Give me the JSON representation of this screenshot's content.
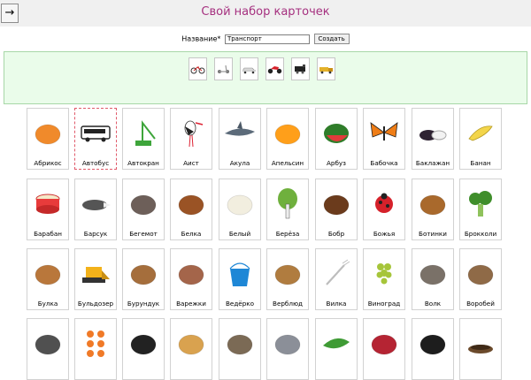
{
  "header": {
    "back_glyph": "→",
    "title": "Свой набор карточек"
  },
  "form": {
    "name_label": "Название*",
    "name_value": "Транспорт",
    "create_label": "Создать"
  },
  "selected": [
    {
      "icon": "bicycle-icon"
    },
    {
      "icon": "scooter-icon"
    },
    {
      "icon": "car-icon"
    },
    {
      "icon": "motorcycle-icon"
    },
    {
      "icon": "locomotive-icon"
    },
    {
      "icon": "truck-icon"
    }
  ],
  "cards": [
    {
      "label": "Абрикос",
      "icon": "apricot-icon",
      "color": "#f08a2b"
    },
    {
      "label": "Автобус",
      "icon": "bus-icon",
      "color": "#ffffff",
      "selected": true
    },
    {
      "label": "Автокран",
      "icon": "crane-icon",
      "color": "#3ea53b"
    },
    {
      "label": "Аист",
      "icon": "stork-icon",
      "color": "#ffffff"
    },
    {
      "label": "Акула",
      "icon": "shark-icon",
      "color": "#5c6b7a"
    },
    {
      "label": "Апельсин",
      "icon": "orange-icon",
      "color": "#ff9f1a"
    },
    {
      "label": "Арбуз",
      "icon": "watermelon-icon",
      "color": "#e23b3b"
    },
    {
      "label": "Бабочка",
      "icon": "butterfly-icon",
      "color": "#ef7d16"
    },
    {
      "label": "Баклажан",
      "icon": "eggplant-icon",
      "color": "#2e2232"
    },
    {
      "label": "Банан",
      "icon": "banana-icon",
      "color": "#f3d54a"
    },
    {
      "label": "Барабан",
      "icon": "drum-icon",
      "color": "#e83b3b"
    },
    {
      "label": "Барсук",
      "icon": "badger-icon",
      "color": "#555555"
    },
    {
      "label": "Бегемот",
      "icon": "hippo-icon",
      "color": "#6d5f59"
    },
    {
      "label": "Белка",
      "icon": "squirrel-icon",
      "color": "#9a5325"
    },
    {
      "label": "Белый",
      "icon": "polar-bear-icon",
      "color": "#f2eedf"
    },
    {
      "label": "Берёза",
      "icon": "birch-icon",
      "color": "#6fb03d"
    },
    {
      "label": "Бобр",
      "icon": "beaver-icon",
      "color": "#6b3b1c"
    },
    {
      "label": "Божья",
      "icon": "ladybug-icon",
      "color": "#d5212a"
    },
    {
      "label": "Ботинки",
      "icon": "boots-icon",
      "color": "#a9692c"
    },
    {
      "label": "Брокколи",
      "icon": "broccoli-icon",
      "color": "#3f8e2b"
    },
    {
      "label": "Булка",
      "icon": "bread-icon",
      "color": "#b9773b"
    },
    {
      "label": "Бульдозер",
      "icon": "bulldozer-icon",
      "color": "#f3b21a"
    },
    {
      "label": "Бурундук",
      "icon": "chipmunk-icon",
      "color": "#a56e3c"
    },
    {
      "label": "Варежки",
      "icon": "mittens-icon",
      "color": "#a4654a"
    },
    {
      "label": "Ведёрко",
      "icon": "bucket-icon",
      "color": "#1e87d6"
    },
    {
      "label": "Верблюд",
      "icon": "camel-icon",
      "color": "#b07c3f"
    },
    {
      "label": "Вилка",
      "icon": "fork-icon",
      "color": "#bdbdbd"
    },
    {
      "label": "Виноград",
      "icon": "grapes-icon",
      "color": "#a6c53a"
    },
    {
      "label": "Волк",
      "icon": "wolf-icon",
      "color": "#7a7168"
    },
    {
      "label": "Воробей",
      "icon": "sparrow-icon",
      "color": "#8f6a47"
    },
    {
      "label": "",
      "icon": "crow-icon",
      "color": "#505050"
    },
    {
      "label": "",
      "icon": "orange-dots-icon",
      "color": "#f07a28"
    },
    {
      "label": "",
      "icon": "raven-icon",
      "color": "#222222"
    },
    {
      "label": "",
      "icon": "cheetah-icon",
      "color": "#d9a24f"
    },
    {
      "label": "",
      "icon": "hyena-icon",
      "color": "#7b6a55"
    },
    {
      "label": "",
      "icon": "pigeon-icon",
      "color": "#8b8f98"
    },
    {
      "label": "",
      "icon": "peas-icon",
      "color": "#3f9b35"
    },
    {
      "label": "",
      "icon": "pomegranate-icon",
      "color": "#b52433"
    },
    {
      "label": "",
      "icon": "rook-icon",
      "color": "#1d1d1d"
    },
    {
      "label": "",
      "icon": "bowl-icon",
      "color": "#6b4a2b"
    }
  ]
}
